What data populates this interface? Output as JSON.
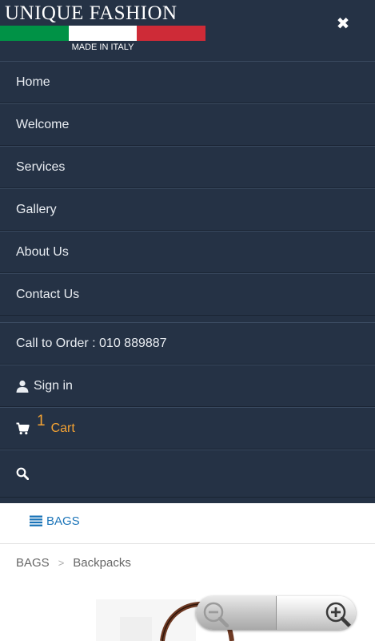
{
  "brand": {
    "name": "UNIQUE FASHION",
    "tagline": "MADE IN ITALY",
    "flag_colors": [
      "#009246",
      "#ffffff",
      "#ce2b37"
    ]
  },
  "header": {
    "close_icon": "close-icon"
  },
  "menu": {
    "items": [
      {
        "label": "Home"
      },
      {
        "label": "Welcome"
      },
      {
        "label": "Services"
      },
      {
        "label": "Gallery"
      },
      {
        "label": "About Us"
      },
      {
        "label": "Contact Us"
      }
    ],
    "call_to_order": "Call to Order : 010 889887",
    "sign_in": "Sign in",
    "cart_count": "1",
    "cart_label": "Cart",
    "search_icon": "search-icon"
  },
  "category": {
    "label": "BAGS",
    "icon": "list-icon"
  },
  "breadcrumb": {
    "items": [
      "BAGS",
      "Backpacks"
    ],
    "separator": ">"
  },
  "zoom": {
    "out_icon": "zoom-out-icon",
    "in_icon": "zoom-in-icon"
  },
  "colors": {
    "nav_bg": "#253245",
    "accent": "#f3a233",
    "link": "#1b74b8"
  }
}
